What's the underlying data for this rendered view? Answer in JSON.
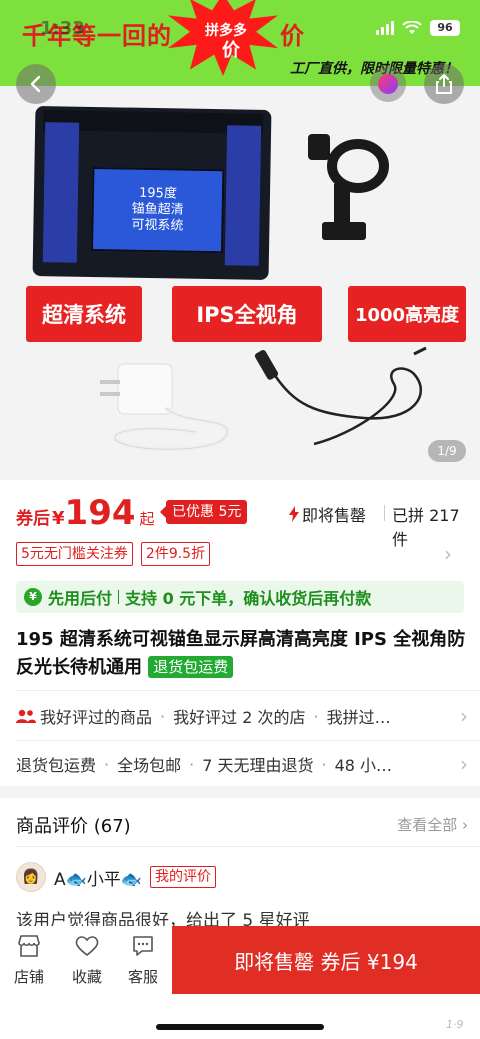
{
  "banner": {
    "title_left": "千年等一回的",
    "title_right": "价",
    "burst_line1": "拼多多",
    "burst_line2": "价",
    "subtitle": "工厂直供，限时限量特惠！"
  },
  "status_bar": {
    "time": "1:33",
    "battery": "96"
  },
  "product_image": {
    "screen_lines": [
      "195度",
      "锚鱼超清",
      "可视系统"
    ],
    "tags": [
      "超清系统",
      "IPS全视角",
      "1000高亮度"
    ],
    "pager": "1/9"
  },
  "price": {
    "label": "券后",
    "currency": "¥",
    "amount": "194",
    "suffix": "起",
    "discount": "已优惠 5元",
    "soon_sold_out": "即将售罄",
    "sold_count": "已拼 217 件"
  },
  "coupons": [
    "5元无门槛关注券",
    "2件9.5折"
  ],
  "pay_later": {
    "title": "先用后付",
    "desc": "支持 0 元下单，确认收货后再付款"
  },
  "product": {
    "title": "195 超清系统可视锚鱼显示屏高清高亮度 IPS 全视角防反光长待机通用",
    "return_badge": "退货包运费"
  },
  "history_row": [
    "我好评过的商品",
    "我好评过 2 次的店",
    "我拼过…"
  ],
  "service_row": [
    "退货包运费",
    "全场包邮",
    "7 天无理由退货",
    "48 小…"
  ],
  "reviews": {
    "title": "商品评价 (67)",
    "see_all": "查看全部",
    "reviewer_name_a": "A",
    "reviewer_name_b": "小平",
    "my_review_tag": "我的评价",
    "text": "该用户觉得商品很好，给出了 5 星好评"
  },
  "bottom_bar": {
    "store": "店铺",
    "favorite": "收藏",
    "service": "客服",
    "buy_button": "即将售罄 券后 ¥194"
  },
  "colors": {
    "accent_red": "#e02020",
    "banner_green": "#7ee03c",
    "pay_green": "#1c8f1c"
  }
}
